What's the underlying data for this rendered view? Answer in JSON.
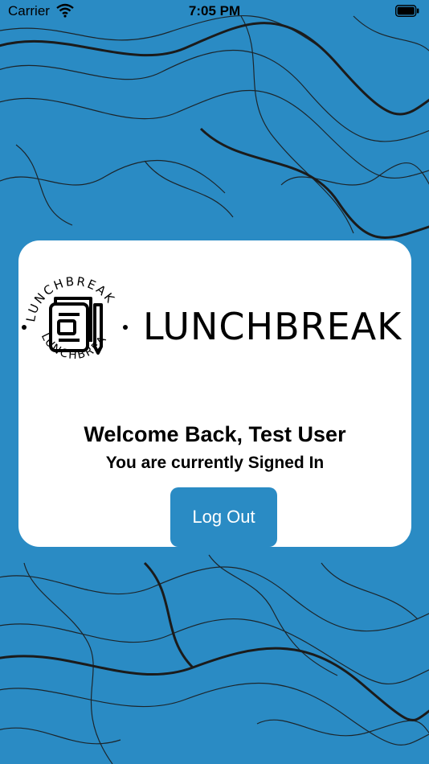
{
  "status_bar": {
    "carrier": "Carrier",
    "time": "7:05 PM"
  },
  "brand": {
    "ring_text": "LUNCHBREAK",
    "wordmark": "LUNCHBREAK"
  },
  "main": {
    "welcome": "Welcome Back, Test User",
    "status_message": "You are currently Signed In",
    "logout_label": "Log Out"
  },
  "colors": {
    "background": "#2a8bc4",
    "card": "#ffffff",
    "button": "#2a8bc4",
    "button_text": "#ffffff",
    "contour_lines": "#1b1b1b"
  },
  "icons": {
    "status": [
      "wifi-icon",
      "battery-icon"
    ],
    "logo": "notebook-pen-icon"
  }
}
